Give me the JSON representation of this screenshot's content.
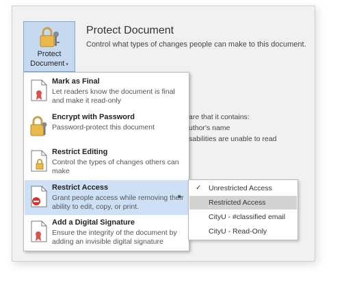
{
  "backstage": {
    "protect_button": {
      "line1": "Protect",
      "line2": "Document",
      "caret": "▾",
      "icon": "lock-key-icon"
    },
    "title": "Protect Document",
    "description": "Control what types of changes people can make to this document.",
    "background_lines": [
      "are that it contains:",
      "uthor's name",
      "sabilities are unable to read"
    ]
  },
  "menu": {
    "items": [
      {
        "title": "Mark as Final",
        "desc": "Let readers know the document is final and make it read-only",
        "icon": "document-ribbon-icon"
      },
      {
        "title": "Encrypt with Password",
        "desc": "Password-protect this document",
        "icon": "lock-key-icon"
      },
      {
        "title": "Restrict Editing",
        "desc": "Control the types of changes others can make",
        "icon": "document-lock-icon"
      },
      {
        "title": "Restrict Access",
        "desc": "Grant people access while removing their ability to edit, copy, or print.",
        "icon": "document-restricted-icon"
      },
      {
        "title": "Add a Digital Signature",
        "desc": "Ensure the integrity of the document by adding an invisible digital signature",
        "icon": "document-signature-icon"
      }
    ],
    "submenu_arrow": "▶"
  },
  "submenu": {
    "items": [
      {
        "label": "Unrestricted Access",
        "check": "✓"
      },
      {
        "label": "Restricted Access",
        "check": ""
      },
      {
        "label": "CityU - #classified email",
        "check": ""
      },
      {
        "label": "CityU - Read-Only",
        "check": ""
      }
    ]
  },
  "colors": {
    "highlight": "#cde0f5",
    "button_bg": "#c5d9f0",
    "submenu_hover": "#d3d3d3",
    "panel_bg": "#f1f1f1"
  }
}
